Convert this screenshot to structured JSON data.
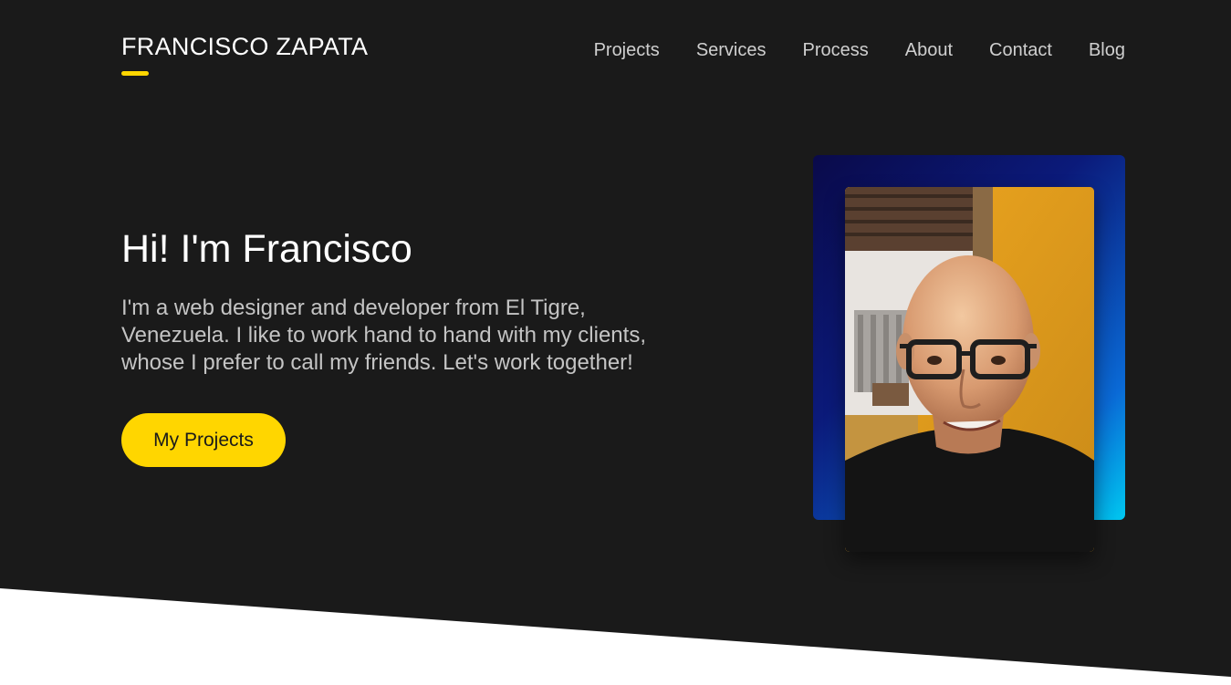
{
  "header": {
    "brand": "FRANCISCO ZAPATA",
    "nav": [
      "Projects",
      "Services",
      "Process",
      "About",
      "Contact",
      "Blog"
    ]
  },
  "hero": {
    "title": "Hi! I'm Francisco",
    "description": "I'm a web designer and developer from El Tigre, Venezuela. I like to work hand to hand with my clients, whose I prefer to call my friends. Let's work together!",
    "cta_label": "My Projects"
  },
  "colors": {
    "background": "#1a1a1a",
    "accent": "#ffd600",
    "nav_text": "#cfcfcf",
    "frame_gradient": [
      "#0a0a4a",
      "#00c8f0"
    ]
  }
}
